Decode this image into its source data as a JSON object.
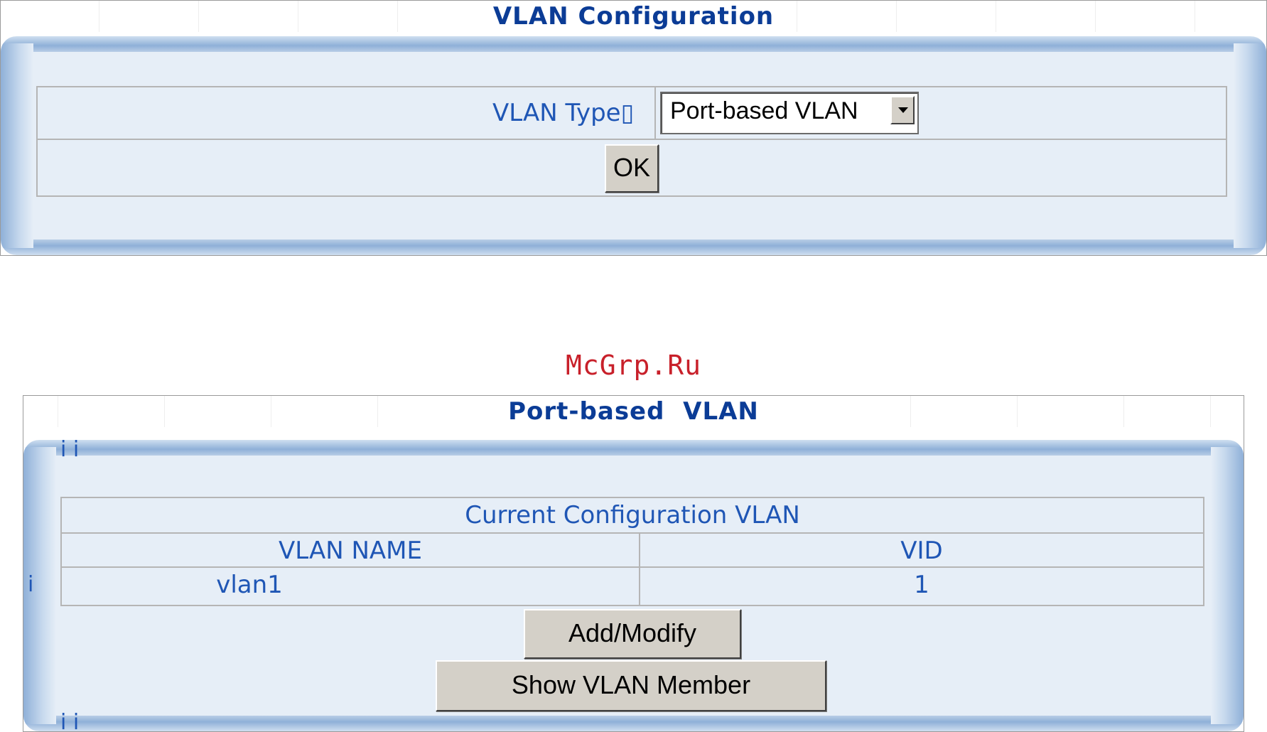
{
  "vlan_config": {
    "title": "VLAN Configuration",
    "vlan_type_label": "VLAN Type▯",
    "vlan_type_value": "Port-based VLAN",
    "ok_label": "OK"
  },
  "watermark": "McGrp.Ru",
  "port_based": {
    "title": "Port-based  VLAN",
    "table_title": "Current Configuration VLAN",
    "columns": [
      "VLAN NAME",
      "VID"
    ],
    "rows": [
      [
        "vlan1",
        "1"
      ]
    ],
    "add_modify_label": "Add/Modify",
    "show_member_label": "Show VLAN Member",
    "marks": [
      "i i",
      "i",
      "i i"
    ]
  },
  "colors": {
    "accent": "#0b3c96",
    "label": "#1f56b5",
    "watermark": "#c8202a",
    "panel_bg": "#e6eef7"
  }
}
